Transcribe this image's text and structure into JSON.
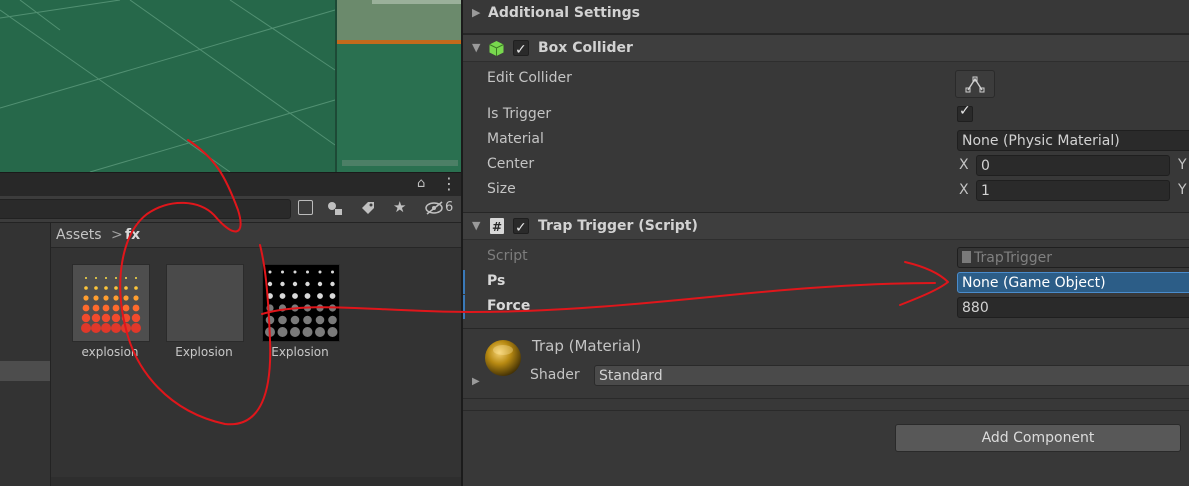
{
  "project": {
    "breadcrumb_root": "Assets",
    "breadcrumb_sep": ">",
    "breadcrumb_folder": "fx",
    "hidden_count": "6",
    "assets": [
      {
        "name": "explosion"
      },
      {
        "name": "Explosion"
      },
      {
        "name": "Explosion"
      }
    ]
  },
  "inspector": {
    "additional_settings": "Additional Settings",
    "box_collider": {
      "title": "Box Collider",
      "edit_collider": "Edit Collider",
      "is_trigger": "Is Trigger",
      "material_label": "Material",
      "material_value": "None (Physic Material)",
      "center_label": "Center",
      "size_label": "Size",
      "axis_x": "X",
      "axis_y": "Y",
      "center_x": "0",
      "size_x": "1"
    },
    "trap_trigger": {
      "title": "Trap Trigger (Script)",
      "script_label": "Script",
      "script_value": "TrapTrigger",
      "ps_label": "Ps",
      "ps_value": "None (Game Object)",
      "force_label": "Force",
      "force_value": "880"
    },
    "material": {
      "name": "Trap (Material)",
      "shader_label": "Shader",
      "shader_value": "Standard"
    },
    "add_component": "Add Component"
  },
  "colors": {
    "scene_green": "#26684a",
    "selection_blue": "#2c5d87",
    "annotation_red": "#e0161b"
  }
}
